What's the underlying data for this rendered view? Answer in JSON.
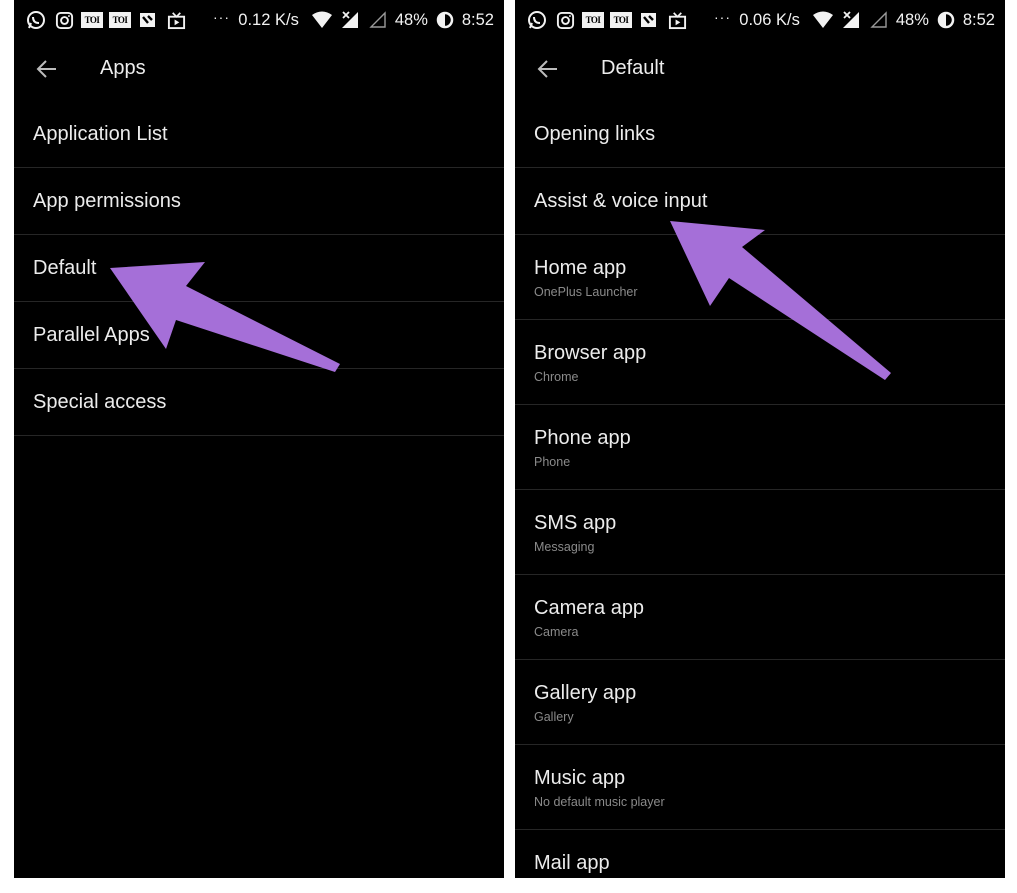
{
  "left": {
    "status": {
      "speed": "0.12 K/s",
      "battery": "48%",
      "time": "8:52",
      "more": "···"
    },
    "title": "Apps",
    "items": [
      {
        "label": "Application List"
      },
      {
        "label": "App permissions"
      },
      {
        "label": "Default"
      },
      {
        "label": "Parallel Apps"
      },
      {
        "label": "Special access"
      }
    ]
  },
  "right": {
    "status": {
      "speed": "0.06 K/s",
      "battery": "48%",
      "time": "8:52",
      "more": "···"
    },
    "title": "Default",
    "items": [
      {
        "label": "Opening links"
      },
      {
        "label": "Assist & voice input"
      },
      {
        "label": "Home app",
        "sub": "OnePlus Launcher"
      },
      {
        "label": "Browser app",
        "sub": "Chrome"
      },
      {
        "label": "Phone app",
        "sub": "Phone"
      },
      {
        "label": "SMS app",
        "sub": "Messaging"
      },
      {
        "label": "Camera app",
        "sub": "Camera"
      },
      {
        "label": "Gallery app",
        "sub": "Gallery"
      },
      {
        "label": "Music app",
        "sub": "No default music player"
      },
      {
        "label": "Mail app"
      }
    ]
  },
  "status_icons": [
    "whatsapp-icon",
    "instagram-icon",
    "toi-icon",
    "toi-icon",
    "news-icon",
    "tv-icon",
    "wifi-icon",
    "signal-icon",
    "signal-empty-icon",
    "battery-icon"
  ],
  "toi_text": "TOI",
  "colors": {
    "background": "#000000",
    "text": "#ececec",
    "subtext": "#8a8a8a",
    "divider": "#262626",
    "arrow": "#a56fd8"
  }
}
